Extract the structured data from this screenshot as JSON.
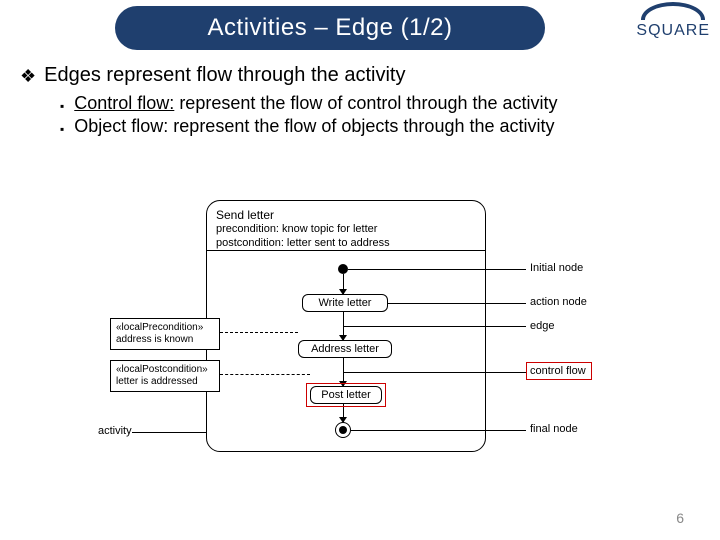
{
  "header": {
    "title": "Activities – Edge (1/2)",
    "logo_text": "SQUARE"
  },
  "bullets": {
    "main": "Edges represent flow through the activity",
    "sub1_u": "Control flow:",
    "sub1_rest": " represent the flow of control through the activity",
    "sub2": "Object flow: represent the flow of objects through the activity"
  },
  "diagram": {
    "title": "Send letter",
    "precond": "precondition: know topic for letter",
    "postcond": "postcondition: letter sent to address",
    "write": "Write letter",
    "address": "Address letter",
    "post": "Post letter",
    "lbl_initial": "Initial node",
    "lbl_action": "action node",
    "lbl_edge": "edge",
    "lbl_control": "control flow",
    "lbl_final": "final node",
    "lbl_activity": "activity",
    "note1_t": "«localPrecondition»",
    "note1_b": "address is known",
    "note2_t": "«localPostcondition»",
    "note2_b": "letter is addressed"
  },
  "page_number": "6"
}
